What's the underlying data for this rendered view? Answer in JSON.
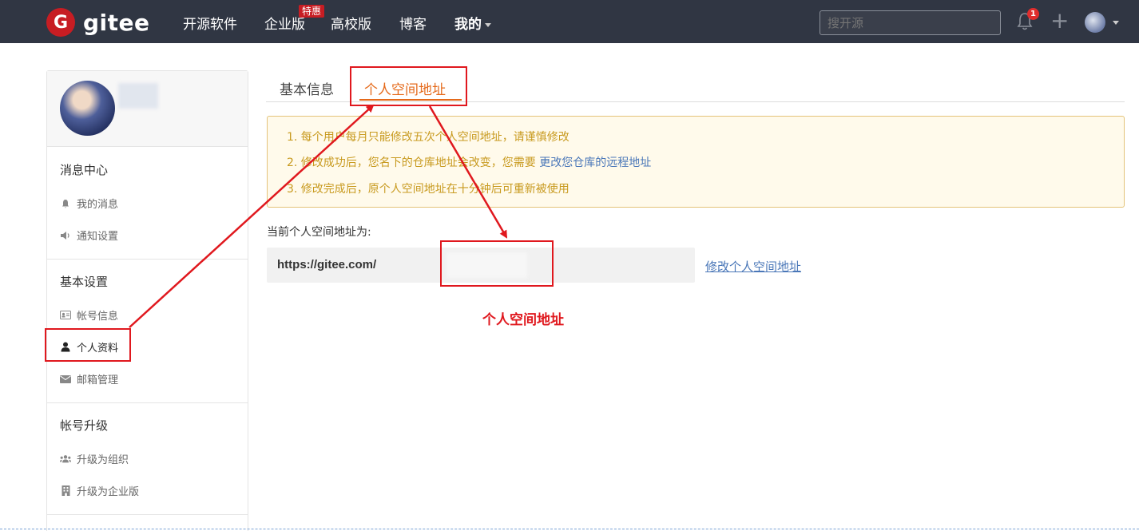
{
  "topnav": {
    "logo_glyph": "G",
    "logo_text": "gitee",
    "items": [
      "开源软件",
      "企业版",
      "高校版",
      "博客",
      "我的"
    ],
    "promo_badge": "特惠",
    "search_placeholder": "搜开源",
    "notification_count": "1",
    "plus_glyph": "+"
  },
  "sidebar": {
    "sections": [
      {
        "title": "消息中心",
        "items": [
          {
            "label": "我的消息",
            "icon": "bell-icon"
          },
          {
            "label": "通知设置",
            "icon": "speaker-icon"
          }
        ]
      },
      {
        "title": "基本设置",
        "items": [
          {
            "label": "帐号信息",
            "icon": "id-card-icon"
          },
          {
            "label": "个人资料",
            "icon": "user-icon",
            "active": true
          },
          {
            "label": "邮箱管理",
            "icon": "envelope-icon"
          }
        ]
      },
      {
        "title": "帐号升级",
        "items": [
          {
            "label": "升级为组织",
            "icon": "users-icon"
          },
          {
            "label": "升级为企业版",
            "icon": "building-icon"
          }
        ]
      }
    ]
  },
  "tabs": [
    {
      "label": "基本信息",
      "active": false
    },
    {
      "label": "个人空间地址",
      "active": true
    }
  ],
  "notice": {
    "line1": "1. 每个用户每月只能修改五次个人空间地址，请谨慎修改",
    "line2_prefix": "2. 修改成功后，您名下的仓库地址会改变，您需要 ",
    "line2_link": "更改您仓库的远程地址",
    "line3": "3. 修改完成后，原个人空间地址在十分钟后可重新被使用"
  },
  "current_label": "当前个人空间地址为:",
  "url_prefix": "https://gitee.com/",
  "edit_link": "修改个人空间地址",
  "annotation_label": "个人空间地址",
  "colors": {
    "nav_bg": "#303643",
    "accent_orange": "#e56a1b",
    "brand_red": "#c71d23",
    "annotation_red": "#e0181e",
    "link_blue": "#4a77b8",
    "notice_text": "#c89a1f"
  }
}
